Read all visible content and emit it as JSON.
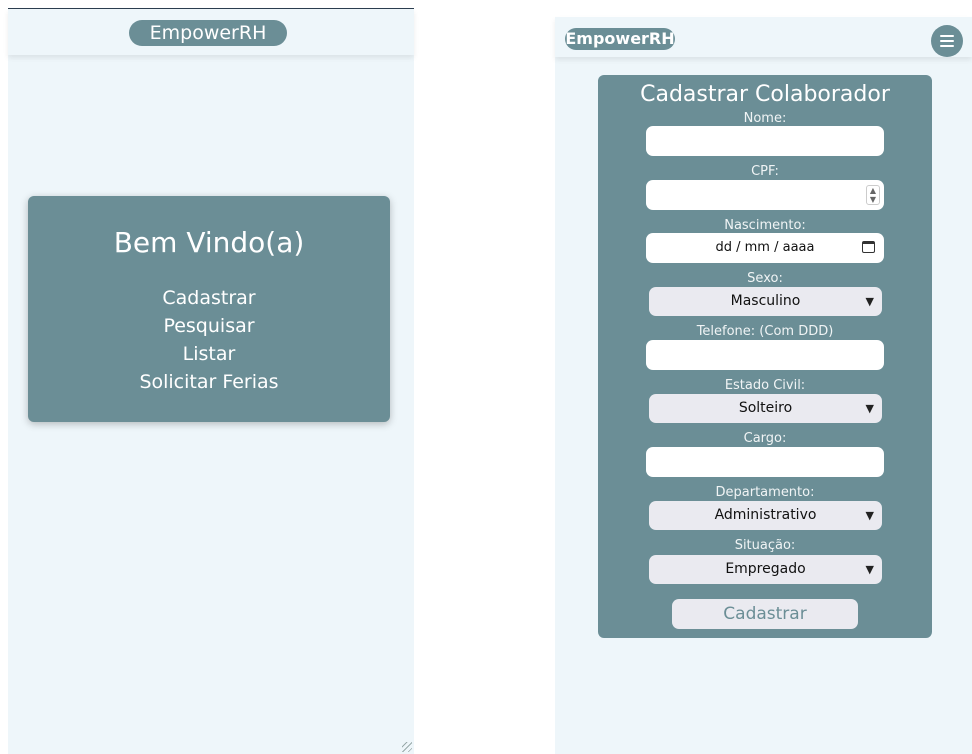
{
  "left_screen": {
    "brand": "EmpowerRH",
    "welcome_title": "Bem Vindo(a)",
    "links": [
      "Cadastrar",
      "Pesquisar",
      "Listar",
      "Solicitar Ferias"
    ]
  },
  "right_screen": {
    "brand": "EmpowerRH",
    "menu_icon": "hamburger-icon",
    "form": {
      "title": "Cadastrar Colaborador",
      "nome_label": "Nome:",
      "nome_value": "",
      "cpf_label": "CPF:",
      "cpf_value": "",
      "nascimento_label": "Nascimento:",
      "nascimento_placeholder": "dd / mm / aaaa",
      "sexo_label": "Sexo:",
      "sexo_value": "Masculino",
      "telefone_label": "Telefone: (Com DDD)",
      "telefone_value": "",
      "estado_civil_label": "Estado Civil:",
      "estado_civil_value": "Solteiro",
      "cargo_label": "Cargo:",
      "cargo_value": "",
      "departamento_label": "Departamento:",
      "departamento_value": "Administrativo",
      "situacao_label": "Situação:",
      "situacao_value": "Empregado",
      "submit_label": "Cadastrar"
    }
  },
  "colors": {
    "accent": "#6b8e96",
    "background": "#eef6fa",
    "select_bg": "#eaeaf0"
  }
}
